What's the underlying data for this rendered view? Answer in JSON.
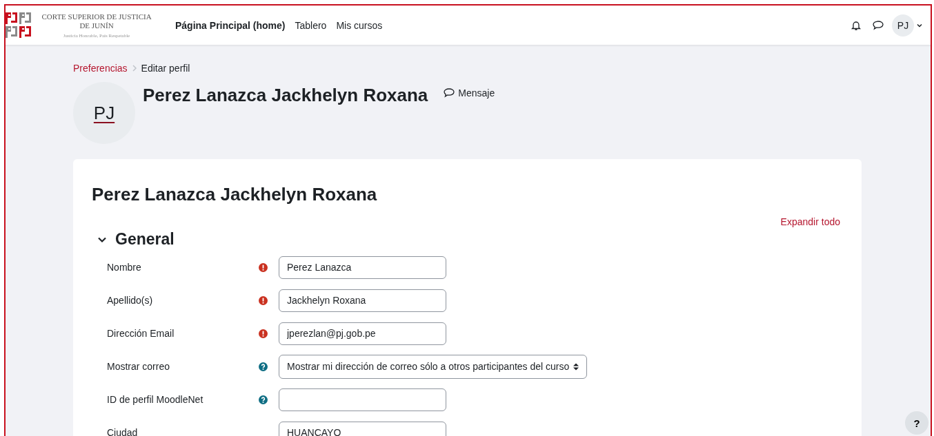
{
  "header": {
    "logo": {
      "lines": [
        "CORTE SUPERIOR DE JUSTICIA",
        "DE JUNÍN"
      ],
      "motto": "Justicia Honrable, País Respetable"
    },
    "nav": [
      {
        "label": "Página Principal (home)",
        "selected": true
      },
      {
        "label": "Tablero",
        "selected": false
      },
      {
        "label": "Mis cursos",
        "selected": false
      }
    ],
    "user_initials": "PJ"
  },
  "breadcrumb": [
    {
      "label": "Preferencias",
      "kind": "link"
    },
    {
      "label": "Editar perfil",
      "kind": "current"
    }
  ],
  "profile": {
    "initials": "PJ",
    "name": "Perez Lanazca Jackhelyn Roxana",
    "message": "Mensaje"
  },
  "form": {
    "title": "Perez Lanazca Jackhelyn Roxana",
    "expand_all": "Expandir todo",
    "section": {
      "title": "General",
      "expanded": true
    },
    "fields": [
      {
        "label": "Nombre",
        "required": true,
        "help": false,
        "kind": "text",
        "value": "Perez Lanazca"
      },
      {
        "label": "Apellido(s)",
        "required": true,
        "help": false,
        "kind": "text",
        "value": "Jackhelyn Roxana"
      },
      {
        "label": "Dirección Email",
        "required": true,
        "help": false,
        "kind": "text",
        "value": "jperezlan@pj.gob.pe"
      },
      {
        "label": "Mostrar correo",
        "required": false,
        "help": true,
        "kind": "select",
        "value": "Mostrar mi dirección de correo sólo a otros participantes del curso"
      },
      {
        "label": "ID de perfil MoodleNet",
        "required": false,
        "help": true,
        "kind": "text"
      },
      {
        "label": "Ciudad",
        "required": false,
        "help": false,
        "kind": "text",
        "value": "HUANCAYO"
      }
    ]
  },
  "help_button": "?"
}
